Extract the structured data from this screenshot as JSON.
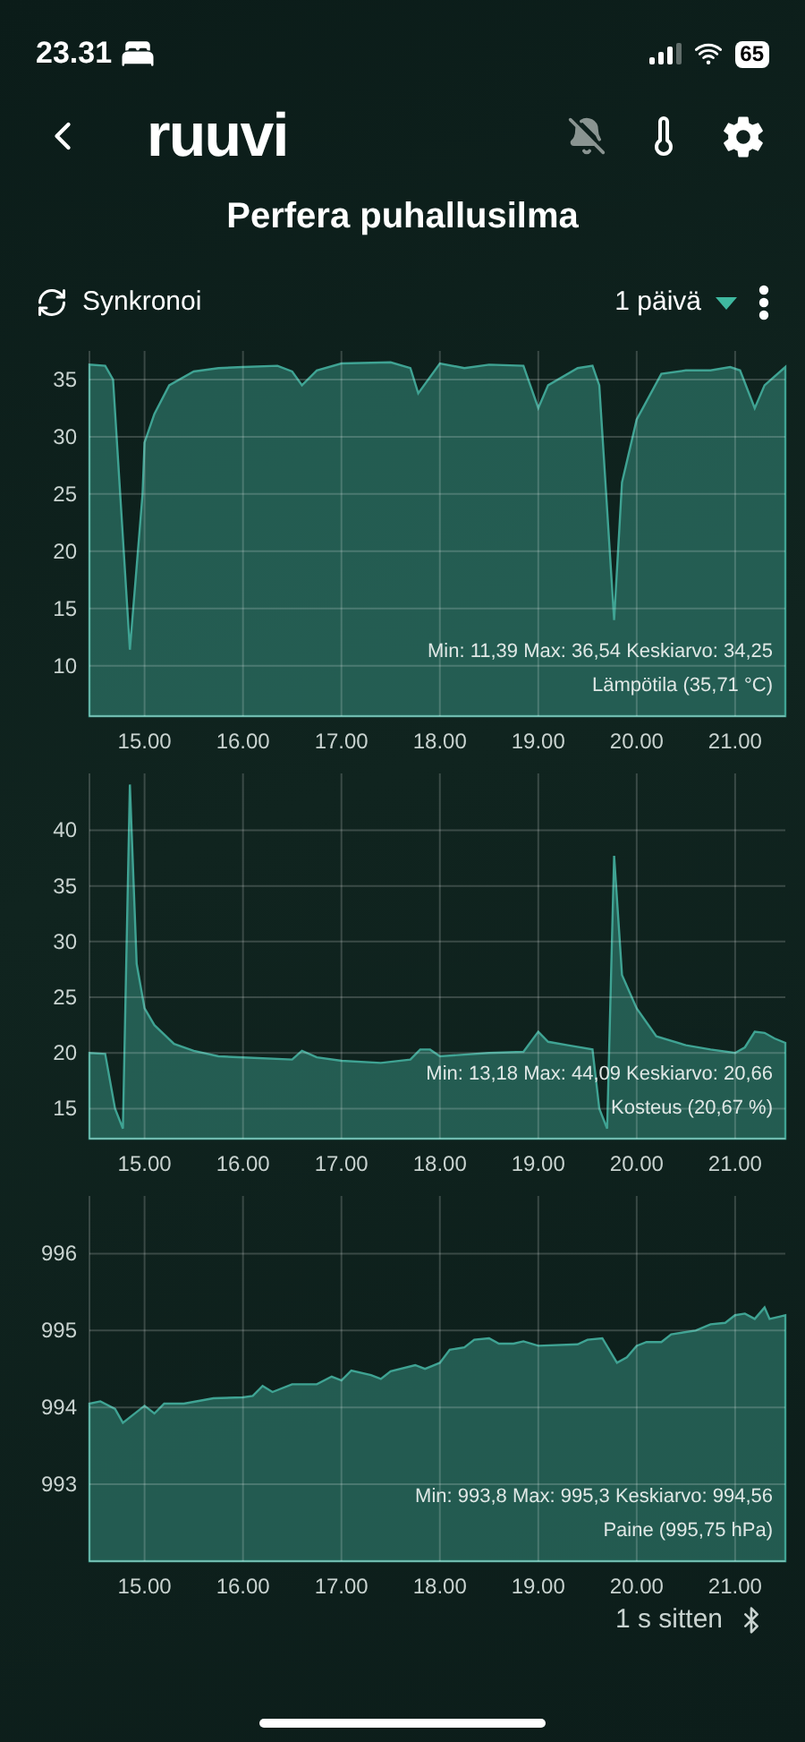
{
  "status_bar": {
    "time": "23.31",
    "battery": "65"
  },
  "header": {
    "logo": "ruuvi",
    "title": "Perfera puhallusilma"
  },
  "toolbar": {
    "sync_label": "Synkronoi",
    "range": "1 päivä"
  },
  "charts": [
    {
      "stats": "Min: 11,39 Max: 36,54 Keskiarvo: 34,25",
      "legend": "Lämpötila (35,71 °C)",
      "chart_data": {
        "type": "area",
        "x": [
          14.44,
          14.6,
          14.68,
          14.85,
          14.98,
          15.0,
          15.1,
          15.25,
          15.5,
          15.75,
          16.0,
          16.35,
          16.5,
          16.6,
          16.75,
          17.0,
          17.5,
          17.7,
          17.78,
          18.0,
          18.25,
          18.5,
          18.85,
          19.0,
          19.1,
          19.4,
          19.55,
          19.62,
          19.77,
          19.85,
          20.0,
          20.25,
          20.5,
          20.75,
          20.95,
          21.05,
          21.2,
          21.3,
          21.51
        ],
        "series": [
          {
            "color": "#3fa393",
            "values": [
              36.3,
              36.2,
              35,
              11.4,
              25,
              29.5,
              32,
              34.5,
              35.7,
              36.0,
              36.1,
              36.2,
              35.7,
              34.5,
              35.8,
              36.4,
              36.5,
              36.0,
              33.8,
              36.4,
              36.0,
              36.3,
              36.2,
              32.5,
              34.5,
              36.0,
              36.2,
              34.5,
              14.0,
              26,
              31.5,
              35.5,
              35.8,
              35.8,
              36.1,
              35.8,
              32.5,
              34.5,
              36.1
            ]
          }
        ],
        "xlim": [
          14.44,
          21.51
        ],
        "ylim": [
          5.6,
          37.5
        ],
        "xticks": [
          {
            "value": 15,
            "label": "15.00"
          },
          {
            "value": 16,
            "label": "16.00"
          },
          {
            "value": 17,
            "label": "17.00"
          },
          {
            "value": 18,
            "label": "18.00"
          },
          {
            "value": 19,
            "label": "19.00"
          },
          {
            "value": 20,
            "label": "20.00"
          },
          {
            "value": 21,
            "label": "21.00"
          }
        ],
        "yticks": [
          10,
          15,
          20,
          25,
          30,
          35
        ],
        "grid": true
      }
    },
    {
      "stats": "Min: 13,18 Max: 44,09 Keskiarvo: 20,66",
      "legend": "Kosteus (20,67 %)",
      "chart_data": {
        "type": "area",
        "x": [
          14.44,
          14.6,
          14.7,
          14.78,
          14.85,
          14.92,
          15.0,
          15.1,
          15.3,
          15.5,
          15.75,
          16.0,
          16.5,
          16.6,
          16.75,
          17.0,
          17.4,
          17.7,
          17.8,
          17.9,
          18.0,
          18.5,
          18.85,
          19.0,
          19.1,
          19.3,
          19.55,
          19.62,
          19.7,
          19.77,
          19.85,
          20.0,
          20.2,
          20.5,
          20.75,
          21.0,
          21.1,
          21.2,
          21.3,
          21.4,
          21.51
        ],
        "series": [
          {
            "color": "#3fa393",
            "values": [
              20,
              19.9,
              15,
              13.2,
              44.1,
              28,
              24,
              22.5,
              20.8,
              20.2,
              19.7,
              19.6,
              19.4,
              20.2,
              19.6,
              19.3,
              19.1,
              19.4,
              20.3,
              20.3,
              19.7,
              20.0,
              20.1,
              21.9,
              21.0,
              20.7,
              20.3,
              15,
              13.2,
              37.7,
              27,
              24,
              21.5,
              20.7,
              20.3,
              20.0,
              20.5,
              21.9,
              21.8,
              21.3,
              20.9
            ]
          }
        ],
        "xlim": [
          14.44,
          21.51
        ],
        "ylim": [
          12.3,
          45.1
        ],
        "xticks": [
          {
            "value": 15,
            "label": "15.00"
          },
          {
            "value": 16,
            "label": "16.00"
          },
          {
            "value": 17,
            "label": "17.00"
          },
          {
            "value": 18,
            "label": "18.00"
          },
          {
            "value": 19,
            "label": "19.00"
          },
          {
            "value": 20,
            "label": "20.00"
          },
          {
            "value": 21,
            "label": "21.00"
          }
        ],
        "yticks": [
          15,
          20,
          25,
          30,
          35,
          40
        ],
        "grid": true
      }
    },
    {
      "stats": "Min: 993,8 Max: 995,3 Keskiarvo: 994,56",
      "legend": "Paine (995,75 hPa)",
      "chart_data": {
        "type": "area",
        "x": [
          14.44,
          14.55,
          14.7,
          14.78,
          15.0,
          15.1,
          15.2,
          15.4,
          15.7,
          16.0,
          16.1,
          16.2,
          16.3,
          16.5,
          16.75,
          16.9,
          17.0,
          17.1,
          17.3,
          17.4,
          17.5,
          17.75,
          17.85,
          18.0,
          18.1,
          18.25,
          18.35,
          18.5,
          18.6,
          18.75,
          18.85,
          19.0,
          19.4,
          19.5,
          19.65,
          19.8,
          19.9,
          20.0,
          20.1,
          20.25,
          20.35,
          20.6,
          20.75,
          20.9,
          21.0,
          21.1,
          21.2,
          21.3,
          21.35,
          21.45,
          21.51
        ],
        "series": [
          {
            "color": "#3fa393",
            "values": [
              994.05,
              994.08,
              993.98,
              993.8,
              994.02,
              993.92,
              994.05,
              994.05,
              994.12,
              994.13,
              994.15,
              994.28,
              994.2,
              994.3,
              994.3,
              994.4,
              994.35,
              994.48,
              994.42,
              994.37,
              994.47,
              994.55,
              994.5,
              994.58,
              994.75,
              994.78,
              994.88,
              994.9,
              994.83,
              994.83,
              994.86,
              994.8,
              994.82,
              994.88,
              994.9,
              994.58,
              994.65,
              994.8,
              994.85,
              994.85,
              994.95,
              995.0,
              995.08,
              995.1,
              995.2,
              995.22,
              995.15,
              995.3,
              995.15,
              995.18,
              995.2
            ]
          }
        ],
        "xlim": [
          14.44,
          21.51
        ],
        "ylim": [
          992.0,
          996.75
        ],
        "xticks": [
          {
            "value": 15,
            "label": "15.00"
          },
          {
            "value": 16,
            "label": "16.00"
          },
          {
            "value": 17,
            "label": "17.00"
          },
          {
            "value": 18,
            "label": "18.00"
          },
          {
            "value": 19,
            "label": "19.00"
          },
          {
            "value": 20,
            "label": "20.00"
          },
          {
            "value": 21,
            "label": "21.00"
          }
        ],
        "yticks": [
          993,
          994,
          995,
          996
        ],
        "grid": true
      }
    }
  ],
  "footer": {
    "updated": "1 s sitten"
  }
}
